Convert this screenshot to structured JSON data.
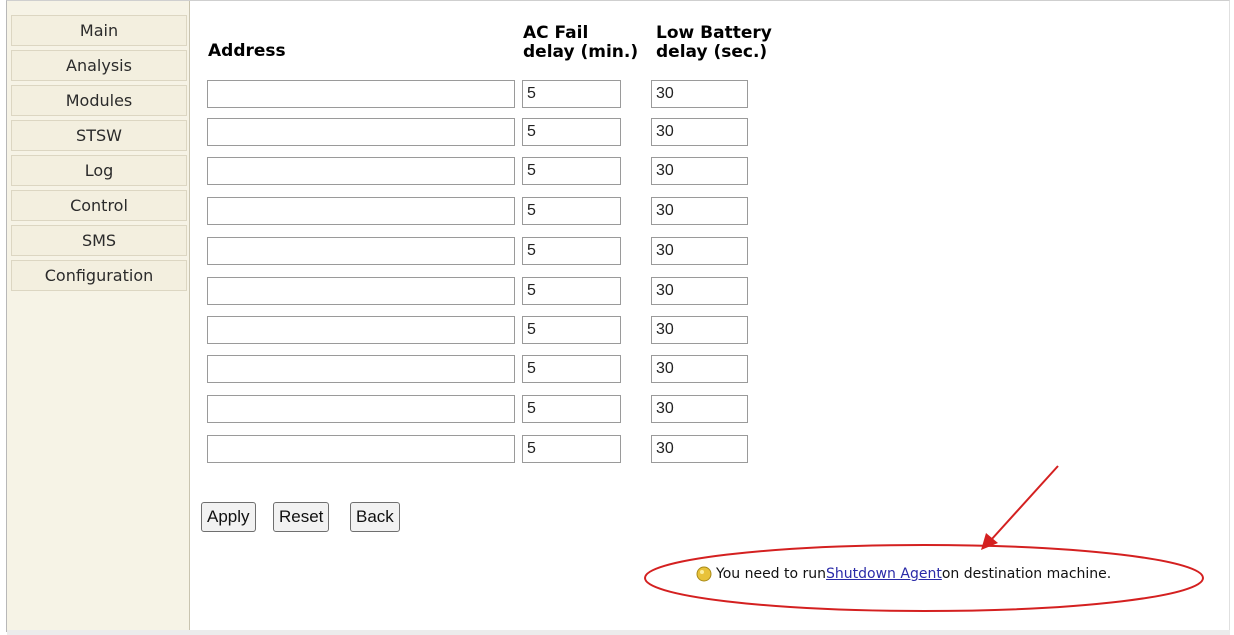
{
  "sidebar": {
    "items": [
      {
        "label": "Main"
      },
      {
        "label": "Analysis"
      },
      {
        "label": "Modules"
      },
      {
        "label": "STSW"
      },
      {
        "label": "Log"
      },
      {
        "label": "Control"
      },
      {
        "label": "SMS"
      },
      {
        "label": "Configuration"
      }
    ]
  },
  "table": {
    "headers": {
      "address": "Address",
      "ac_fail_line1": "AC Fail",
      "ac_fail_line2": "delay (min.)",
      "low_battery_line1": "Low Battery",
      "low_battery_line2": "delay (sec.)"
    },
    "rows": [
      {
        "address": "",
        "ac_fail": "5",
        "low_battery": "30"
      },
      {
        "address": "",
        "ac_fail": "5",
        "low_battery": "30"
      },
      {
        "address": "",
        "ac_fail": "5",
        "low_battery": "30"
      },
      {
        "address": "",
        "ac_fail": "5",
        "low_battery": "30"
      },
      {
        "address": "",
        "ac_fail": "5",
        "low_battery": "30"
      },
      {
        "address": "",
        "ac_fail": "5",
        "low_battery": "30"
      },
      {
        "address": "",
        "ac_fail": "5",
        "low_battery": "30"
      },
      {
        "address": "",
        "ac_fail": "5",
        "low_battery": "30"
      },
      {
        "address": "",
        "ac_fail": "5",
        "low_battery": "30"
      },
      {
        "address": "",
        "ac_fail": "5",
        "low_battery": "30"
      }
    ]
  },
  "buttons": {
    "apply": "Apply",
    "reset": "Reset",
    "back": "Back"
  },
  "notice": {
    "icon": "info-bulb-icon",
    "text_before": "You need to run ",
    "link": "Shutdown Agent",
    "text_after": " on destination machine."
  },
  "annotation": {
    "color": "#d42020"
  }
}
